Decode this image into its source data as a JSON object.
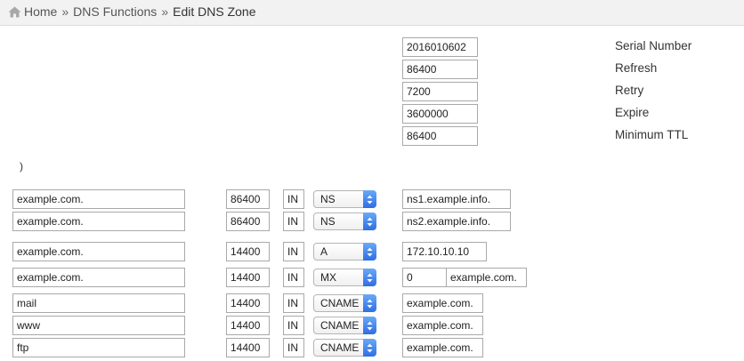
{
  "breadcrumb": {
    "home": "Home",
    "sep1": "»",
    "dns_functions": "DNS Functions",
    "sep2": "»",
    "current": "Edit DNS Zone"
  },
  "soa": {
    "serial": {
      "label": "Serial Number",
      "value": "2016010602"
    },
    "refresh": {
      "label": "Refresh",
      "value": "86400"
    },
    "retry": {
      "label": "Retry",
      "value": "7200"
    },
    "expire": {
      "label": "Expire",
      "value": "3600000"
    },
    "minimum": {
      "label": "Minimum TTL",
      "value": "86400"
    },
    "closing": ")"
  },
  "records": [
    {
      "name": "example.com.",
      "ttl": "86400",
      "class": "IN",
      "type": "NS",
      "value": "ns1.example.info."
    },
    {
      "name": "example.com.",
      "ttl": "86400",
      "class": "IN",
      "type": "NS",
      "value": "ns2.example.info."
    },
    {
      "name": "example.com.",
      "ttl": "14400",
      "class": "IN",
      "type": "A",
      "value": "172.10.10.10"
    },
    {
      "name": "example.com.",
      "ttl": "14400",
      "class": "IN",
      "type": "MX",
      "priority": "0",
      "value": "example.com."
    },
    {
      "name": "mail",
      "ttl": "14400",
      "class": "IN",
      "type": "CNAME",
      "value": "example.com."
    },
    {
      "name": "www",
      "ttl": "14400",
      "class": "IN",
      "type": "CNAME",
      "value": "example.com."
    },
    {
      "name": "ftp",
      "ttl": "14400",
      "class": "IN",
      "type": "CNAME",
      "value": "example.com."
    }
  ]
}
